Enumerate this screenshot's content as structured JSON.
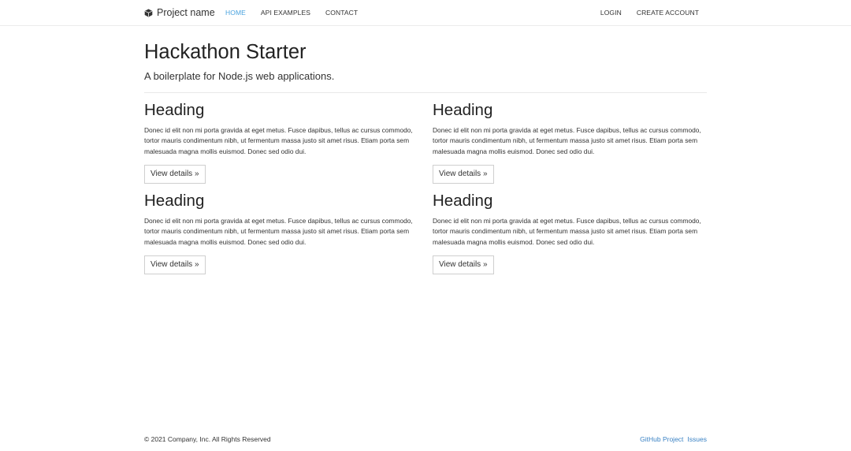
{
  "navbar": {
    "brand": {
      "icon": "cube-icon",
      "label": "Project name"
    },
    "links": [
      {
        "label": "Home",
        "active": true
      },
      {
        "label": "API Examples",
        "active": false
      },
      {
        "label": "Contact",
        "active": false
      }
    ],
    "right_links": [
      {
        "label": "Login"
      },
      {
        "label": "Create Account"
      }
    ],
    "active_color": "#4aa3df"
  },
  "hero": {
    "title": "Hackathon Starter",
    "lead": "A boilerplate for Node.js web applications."
  },
  "cards": [
    {
      "heading": "Heading",
      "body": "Donec id elit non mi porta gravida at eget metus. Fusce dapibus, tellus ac cursus commodo, tortor mauris condimentum nibh, ut fermentum massa justo sit amet risus. Etiam porta sem malesuada magna mollis euismod. Donec sed odio dui.",
      "button": "View details »"
    },
    {
      "heading": "Heading",
      "body": "Donec id elit non mi porta gravida at eget metus. Fusce dapibus, tellus ac cursus commodo, tortor mauris condimentum nibh, ut fermentum massa justo sit amet risus. Etiam porta sem malesuada magna mollis euismod. Donec sed odio dui.",
      "button": "View details »"
    },
    {
      "heading": "Heading",
      "body": "Donec id elit non mi porta gravida at eget metus. Fusce dapibus, tellus ac cursus commodo, tortor mauris condimentum nibh, ut fermentum massa justo sit amet risus. Etiam porta sem malesuada magna mollis euismod. Donec sed odio dui.",
      "button": "View details »"
    },
    {
      "heading": "Heading",
      "body": "Donec id elit non mi porta gravida at eget metus. Fusce dapibus, tellus ac cursus commodo, tortor mauris condimentum nibh, ut fermentum massa justo sit amet risus. Etiam porta sem malesuada magna mollis euismod. Donec sed odio dui.",
      "button": "View details »"
    }
  ],
  "footer": {
    "copyright": "© 2021 Company, Inc. All Rights Reserved",
    "links": [
      {
        "label": "GitHub Project"
      },
      {
        "label": "Issues"
      }
    ],
    "link_color": "#3a82c4"
  }
}
